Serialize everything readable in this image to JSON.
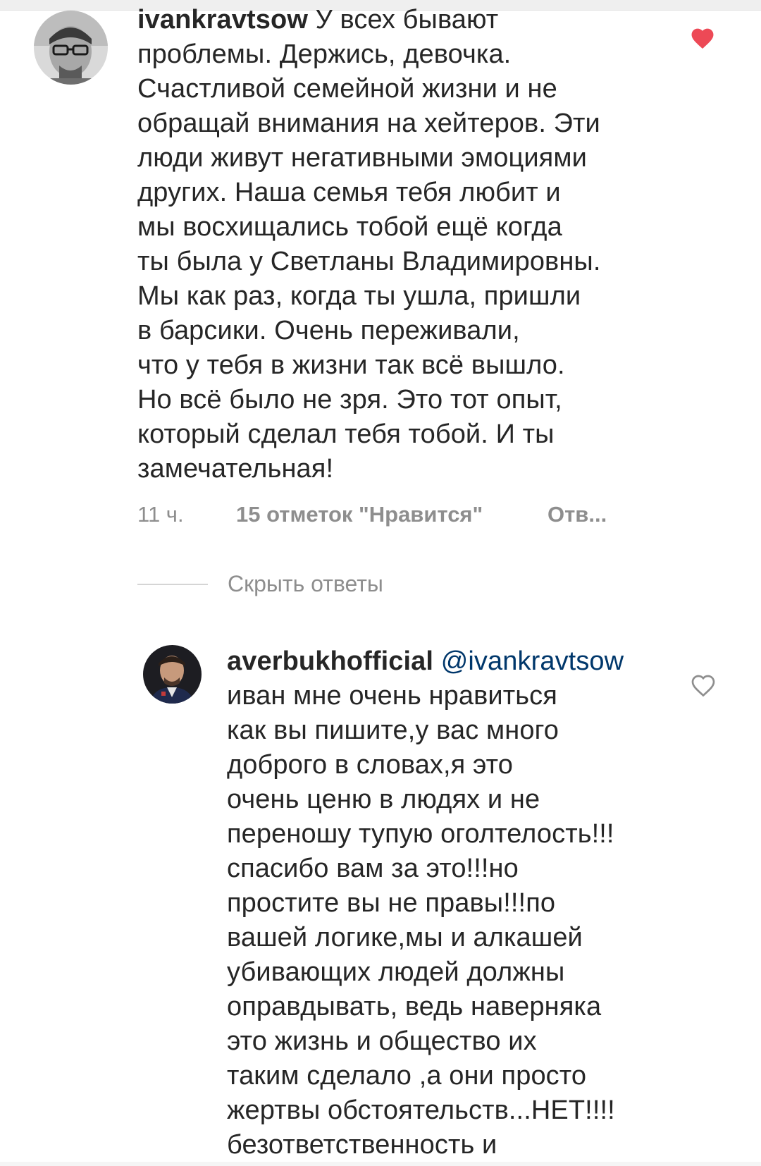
{
  "comments": [
    {
      "username": "ivankravtsow",
      "text": "У всех бывают\nпроблемы. Держись, девочка.\nСчастливой семейной жизни и не\nобращай внимания на хейтеров. Эти\nлюди живут негативными эмоциями\nдругих. Наша семья тебя любит и\nмы восхищались тобой ещё когда\nты была у Светланы Владимировны.\nМы как раз, когда ты ушла, пришли\nв барсики. Очень переживали,\nчто у тебя в жизни так всё вышло.\nНо всё было не зря. Это тот опыт,\nкоторый сделал тебя тобой. И ты\nзамечательная!",
      "time": "11 ч.",
      "likes": "15 отметок \"Нравится\"",
      "reply": "Отв...",
      "liked": true,
      "heart_icon": "heart-filled-icon",
      "heart_color": "#ed4956"
    }
  ],
  "hide_replies_label": "Скрыть ответы",
  "replies": [
    {
      "username": "averbukhofficial",
      "mention": "@ivankravtsow",
      "text": "иван мне очень нравиться\nкак вы пишите,у вас много\nдоброго в словах,я это\nочень ценю в людях и не\nпереношу тупую оголтелость!!!\nспасибо вам за это!!!но\nпростите вы не правы!!!по\nвашей логике,мы и алкашей\nубивающих людей должны\nоправдывать, ведь наверняка\nэто жизнь и общество их\nтаким сделало ,а они просто\nжертвы обстоятельств...НЕТ!!!!\nбезответственность и",
      "liked": false,
      "heart_icon": "heart-outline-icon",
      "heart_color": "#8e8e8e"
    }
  ]
}
